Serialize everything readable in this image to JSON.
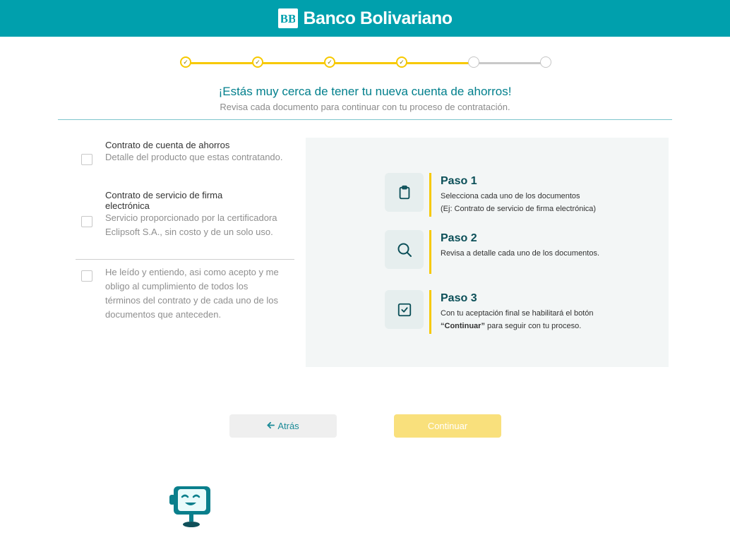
{
  "header": {
    "brand_name": "Banco Bolivariano",
    "logo_text": "BB"
  },
  "stepper": {
    "total_steps": 6,
    "completed_steps": 4,
    "check_glyph": "✓"
  },
  "intro": {
    "title": "¡Estás muy cerca de tener tu nueva cuenta de ahorros!",
    "subtitle": "Revisa cada documento para continuar con tu proceso de contratación."
  },
  "documents": [
    {
      "title": "Contrato de cuenta de ahorros",
      "description": "Detalle del producto que estas contratando.",
      "checked": false
    },
    {
      "title": "Contrato de servicio de firma electrónica",
      "description": "Servicio proporcionado por la certificadora Eclipsoft S.A., sin costo y de un solo uso.",
      "checked": false
    }
  ],
  "acceptance": {
    "text": "He leído y entiendo, asi como acepto y me obligo al cumplimiento de todos los términos del contrato y de cada uno de los documentos que anteceden.",
    "checked": false
  },
  "instructions": [
    {
      "title": "Paso 1",
      "line1": "Selecciona cada uno de los documentos",
      "line2": "(Ej: Contrato de servicio de firma electrónica)",
      "icon": "clipboard-icon"
    },
    {
      "title": "Paso 2",
      "line1": "Revisa a detalle cada uno de los documentos.",
      "line2": "",
      "icon": "search-icon"
    },
    {
      "title": "Paso 3",
      "line1": "Con tu aceptación final se habilitará el botón",
      "line2_bold": "“Continuar”",
      "line2_rest": " para seguir con tu proceso.",
      "icon": "checkbox-icon"
    }
  ],
  "buttons": {
    "back_label": "Atrás",
    "back_arrow": "🡐",
    "continue_label": "Continuar",
    "continue_enabled": false
  },
  "colors": {
    "brand": "#00a0ad",
    "accent": "#f7c900",
    "headline": "#007f8c"
  }
}
